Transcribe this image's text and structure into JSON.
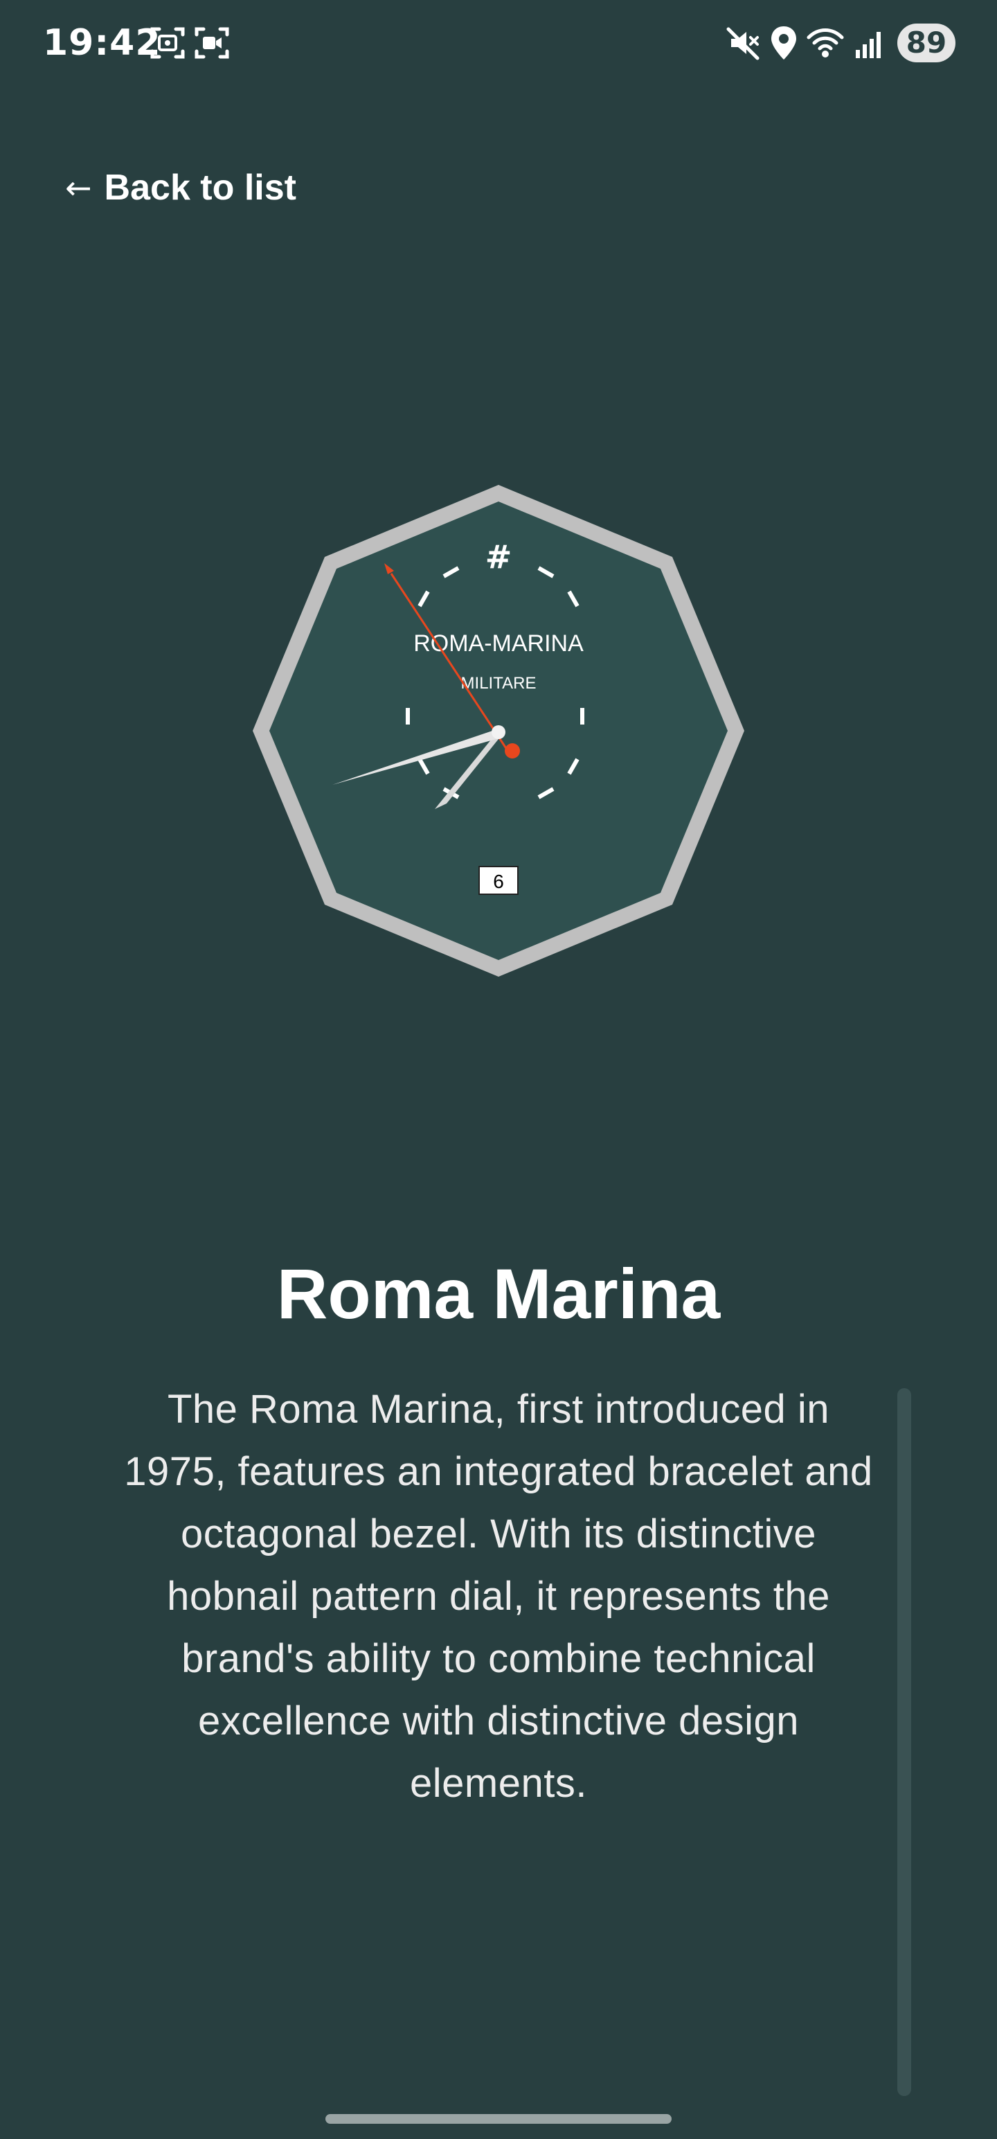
{
  "status_bar": {
    "time": "19:42",
    "battery": "89",
    "left_icons": [
      "screenshot-icon",
      "screen-record-icon"
    ],
    "right_icons": [
      "mute-icon",
      "location-icon",
      "wifi-icon",
      "signal-icon",
      "battery-icon"
    ]
  },
  "nav": {
    "back_arrow": "←",
    "back_label": "Back to list"
  },
  "watch_face": {
    "brand": "ROMA-MARINA",
    "subtitle": "MILITARE",
    "date": "6",
    "twelve_marker": "#",
    "bezel_color": "#BFBFBF",
    "dial_color": "#2F504F",
    "seconds_hand_color": "#E8471E"
  },
  "detail": {
    "title": "Roma Marina",
    "description": "The Roma Marina, first introduced in 1975, features an integrated bracelet and octagonal bezel. With its distinctive hobnail pattern dial, it represents the brand's ability to combine technical excellence with distinctive design elements."
  },
  "colors": {
    "background": "#283F40",
    "text": "#FFFFFF"
  }
}
